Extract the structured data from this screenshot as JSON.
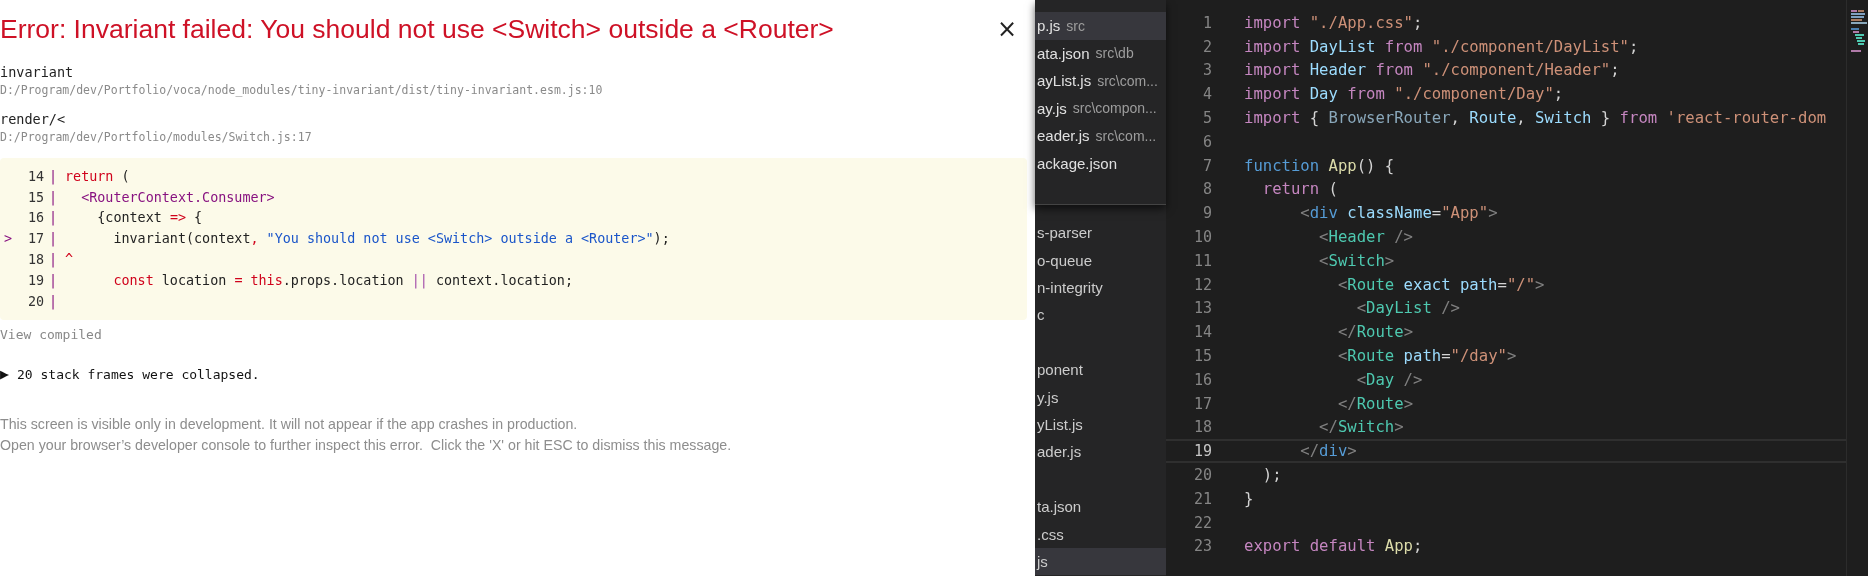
{
  "error_overlay": {
    "title": "Error: Invariant failed: You should not use <Switch> outside a <Router>",
    "close": "×",
    "frames": [
      {
        "function": "invariant",
        "location": "D:/Program/dev/Portfolio/voca/node_modules/tiny-invariant/dist/tiny-invariant.esm.js:10"
      },
      {
        "function": "render/<",
        "location": "D:/Program/dev/Portfolio/modules/Switch.js:17"
      }
    ],
    "code_lines": [
      {
        "num": "14",
        "sep": "|",
        "tokens": [
          {
            "text": "return",
            "kind": "keyword"
          },
          {
            "text": " (",
            "kind": "plain"
          }
        ]
      },
      {
        "num": "15",
        "sep": "|",
        "tokens": [
          {
            "text": "  <RouterContext.Consumer>",
            "kind": "jsx"
          }
        ]
      },
      {
        "num": "16",
        "sep": "|",
        "tokens": [
          {
            "text": "    {context ",
            "kind": "plain"
          },
          {
            "text": "=>",
            "kind": "keyword"
          },
          {
            "text": " {",
            "kind": "plain"
          }
        ]
      },
      {
        "num": "17",
        "sep": "|",
        "marker": ">",
        "tokens": [
          {
            "text": "      invariant(context",
            "kind": "plain"
          },
          {
            "text": ",",
            "kind": "keyword"
          },
          {
            "text": " \"You should not use <Switch> outside a <Router>\"",
            "kind": "string"
          },
          {
            "text": ");",
            "kind": "plain"
          }
        ]
      },
      {
        "num": "18",
        "sep": "|",
        "tokens": [
          {
            "text": "^",
            "kind": "keyword"
          }
        ]
      },
      {
        "num": "19",
        "sep": "|",
        "tokens": [
          {
            "text": "      const",
            "kind": "keyword"
          },
          {
            "text": " location ",
            "kind": "plain"
          },
          {
            "text": "=",
            "kind": "keyword"
          },
          {
            "text": " this",
            "kind": "keyword"
          },
          {
            "text": ".props.location ",
            "kind": "plain"
          },
          {
            "text": "||",
            "kind": "operator"
          },
          {
            "text": " context.location;",
            "kind": "plain"
          }
        ]
      },
      {
        "num": "20",
        "sep": "|"
      }
    ],
    "view_compiled": "View compiled",
    "collapsed": {
      "arrow": "▶",
      "text": "20 stack frames were collapsed."
    },
    "footer": [
      "This screen is visible only in development. It will not appear if the app crashes in production.",
      "Open your browser’s developer console to further inspect this error.  Click the 'X' or hit ESC to dismiss this message."
    ]
  },
  "quick_open": [
    {
      "name": "p.js",
      "path": "src",
      "selected": true
    },
    {
      "name": "ata.json",
      "path": "src\\db",
      "selected": false
    },
    {
      "name": "ayList.js",
      "path": "src\\com...",
      "selected": false
    },
    {
      "name": "ay.js",
      "path": "src\\compon...",
      "selected": false
    },
    {
      "name": "eader.js",
      "path": "src\\com...",
      "selected": false
    },
    {
      "name": "ackage.json",
      "selected": false
    }
  ],
  "explorer": [
    {
      "name": "s-parser",
      "gap_before": false,
      "selected": false
    },
    {
      "name": "o-queue",
      "gap_before": false,
      "selected": false
    },
    {
      "name": "n-integrity",
      "gap_before": false,
      "selected": false
    },
    {
      "name": "c",
      "gap_before": false,
      "selected": false
    },
    {
      "name": "ponent",
      "gap_before": true,
      "selected": false
    },
    {
      "name": "y.js",
      "gap_before": false,
      "selected": false
    },
    {
      "name": "yList.js",
      "gap_before": false,
      "selected": false
    },
    {
      "name": "ader.js",
      "gap_before": false,
      "selected": false
    },
    {
      "name": "ta.json",
      "gap_before": true,
      "selected": false
    },
    {
      "name": ".css",
      "gap_before": false,
      "selected": false
    },
    {
      "name": "js",
      "gap_before": false,
      "selected": true
    }
  ],
  "editor_lines": [
    {
      "num": "1",
      "current": false,
      "tokens": [
        {
          "text": "import",
          "kind": "keyword"
        },
        {
          "text": " \"./App.css\"",
          "kind": "string"
        },
        {
          "text": ";",
          "kind": "plain"
        }
      ]
    },
    {
      "num": "2",
      "current": false,
      "tokens": [
        {
          "text": "import",
          "kind": "keyword"
        },
        {
          "text": " DayList",
          "kind": "variable"
        },
        {
          "text": " from",
          "kind": "keyword"
        },
        {
          "text": " \"./component/DayList\"",
          "kind": "string"
        },
        {
          "text": ";",
          "kind": "plain"
        }
      ]
    },
    {
      "num": "3",
      "current": false,
      "tokens": [
        {
          "text": "import",
          "kind": "keyword"
        },
        {
          "text": " Header",
          "kind": "variable"
        },
        {
          "text": " from",
          "kind": "keyword"
        },
        {
          "text": " \"./component/Header\"",
          "kind": "string"
        },
        {
          "text": ";",
          "kind": "plain"
        }
      ]
    },
    {
      "num": "4",
      "current": false,
      "tokens": [
        {
          "text": "import",
          "kind": "keyword"
        },
        {
          "text": " Day",
          "kind": "variable"
        },
        {
          "text": " from",
          "kind": "keyword"
        },
        {
          "text": " \"./component/Day\"",
          "kind": "string"
        },
        {
          "text": ";",
          "kind": "plain"
        }
      ]
    },
    {
      "num": "5",
      "current": false,
      "tokens": [
        {
          "text": "import",
          "kind": "keyword"
        },
        {
          "text": " { ",
          "kind": "plain"
        },
        {
          "text": "BrowserRouter",
          "kind": "unused"
        },
        {
          "text": ", ",
          "kind": "plain"
        },
        {
          "text": "Route",
          "kind": "variable"
        },
        {
          "text": ", ",
          "kind": "plain"
        },
        {
          "text": "Switch",
          "kind": "variable"
        },
        {
          "text": " } ",
          "kind": "plain"
        },
        {
          "text": "from",
          "kind": "keyword"
        },
        {
          "text": " 'react-router-dom",
          "kind": "string"
        }
      ]
    },
    {
      "num": "6",
      "current": false
    },
    {
      "num": "7",
      "current": false,
      "tokens": [
        {
          "text": "function",
          "kind": "declaration"
        },
        {
          "text": " App",
          "kind": "function"
        },
        {
          "text": "() {",
          "kind": "plain"
        }
      ]
    },
    {
      "num": "8",
      "current": false,
      "tokens": [
        {
          "text": "  return",
          "kind": "keyword"
        },
        {
          "text": " (",
          "kind": "plain"
        }
      ]
    },
    {
      "num": "9",
      "current": false,
      "tokens": [
        {
          "text": "      <",
          "kind": "bracket"
        },
        {
          "text": "div",
          "kind": "declaration"
        },
        {
          "text": " className",
          "kind": "variable"
        },
        {
          "text": "=",
          "kind": "plain"
        },
        {
          "text": "\"App\"",
          "kind": "string"
        },
        {
          "text": ">",
          "kind": "bracket"
        }
      ]
    },
    {
      "num": "10",
      "current": false,
      "tokens": [
        {
          "text": "        <",
          "kind": "bracket"
        },
        {
          "text": "Header",
          "kind": "tag"
        },
        {
          "text": " />",
          "kind": "bracket"
        }
      ]
    },
    {
      "num": "11",
      "current": false,
      "tokens": [
        {
          "text": "        <",
          "kind": "bracket"
        },
        {
          "text": "Switch",
          "kind": "tag"
        },
        {
          "text": ">",
          "kind": "bracket"
        }
      ]
    },
    {
      "num": "12",
      "current": false,
      "tokens": [
        {
          "text": "          <",
          "kind": "bracket"
        },
        {
          "text": "Route",
          "kind": "tag"
        },
        {
          "text": " exact path",
          "kind": "variable"
        },
        {
          "text": "=",
          "kind": "plain"
        },
        {
          "text": "\"/\"",
          "kind": "string"
        },
        {
          "text": ">",
          "kind": "bracket"
        }
      ]
    },
    {
      "num": "13",
      "current": false,
      "tokens": [
        {
          "text": "            <",
          "kind": "bracket"
        },
        {
          "text": "DayList",
          "kind": "tag"
        },
        {
          "text": " />",
          "kind": "bracket"
        }
      ]
    },
    {
      "num": "14",
      "current": false,
      "tokens": [
        {
          "text": "          </",
          "kind": "bracket"
        },
        {
          "text": "Route",
          "kind": "tag"
        },
        {
          "text": ">",
          "kind": "bracket"
        }
      ]
    },
    {
      "num": "15",
      "current": false,
      "tokens": [
        {
          "text": "          <",
          "kind": "bracket"
        },
        {
          "text": "Route",
          "kind": "tag"
        },
        {
          "text": " path",
          "kind": "variable"
        },
        {
          "text": "=",
          "kind": "plain"
        },
        {
          "text": "\"/day\"",
          "kind": "string"
        },
        {
          "text": ">",
          "kind": "bracket"
        }
      ]
    },
    {
      "num": "16",
      "current": false,
      "tokens": [
        {
          "text": "            <",
          "kind": "bracket"
        },
        {
          "text": "Day",
          "kind": "tag"
        },
        {
          "text": " />",
          "kind": "bracket"
        }
      ]
    },
    {
      "num": "17",
      "current": false,
      "tokens": [
        {
          "text": "          </",
          "kind": "bracket"
        },
        {
          "text": "Route",
          "kind": "tag"
        },
        {
          "text": ">",
          "kind": "bracket"
        }
      ]
    },
    {
      "num": "18",
      "current": false,
      "tokens": [
        {
          "text": "        </",
          "kind": "bracket"
        },
        {
          "text": "Switch",
          "kind": "tag"
        },
        {
          "text": ">",
          "kind": "bracket"
        }
      ]
    },
    {
      "num": "19",
      "current": true,
      "tokens": [
        {
          "text": "      </",
          "kind": "bracket"
        },
        {
          "text": "div",
          "kind": "declaration"
        },
        {
          "text": ">",
          "kind": "bracket"
        }
      ]
    },
    {
      "num": "20",
      "current": false,
      "tokens": [
        {
          "text": "  );",
          "kind": "plain"
        }
      ]
    },
    {
      "num": "21",
      "current": false,
      "tokens": [
        {
          "text": "}",
          "kind": "plain"
        }
      ]
    },
    {
      "num": "22",
      "current": false
    },
    {
      "num": "23",
      "current": false,
      "tokens": [
        {
          "text": "export default",
          "kind": "keyword"
        },
        {
          "text": " App",
          "kind": "function"
        },
        {
          "text": ";",
          "kind": "plain"
        }
      ]
    }
  ]
}
